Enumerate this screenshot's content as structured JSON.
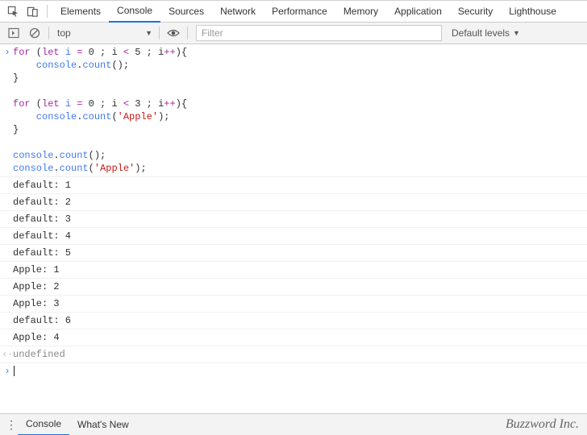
{
  "tabs": {
    "items": [
      "Elements",
      "Console",
      "Sources",
      "Network",
      "Performance",
      "Memory",
      "Application",
      "Security",
      "Lighthouse"
    ],
    "activeIndex": 1
  },
  "toolbar": {
    "context": "top",
    "filter_placeholder": "Filter",
    "levels_label": "Default levels"
  },
  "code": {
    "for1_a": "for",
    "for1_b": " (",
    "for1_c": "let",
    "for1_d": " i ",
    "for1_e": "=",
    "for1_f": " 0 ; i ",
    "for1_g": "<",
    "for1_h": " 5 ; i",
    "for1_i": "++",
    "for1_j": "){",
    "count1_a": "    console",
    "count1_b": ".",
    "count1_c": "count",
    "count1_d": "();",
    "brace1": "}",
    "blank": "",
    "for2_a": "for",
    "for2_b": " (",
    "for2_c": "let",
    "for2_d": " i ",
    "for2_e": "=",
    "for2_f": " 0 ; i ",
    "for2_g": "<",
    "for2_h": " 3 ; i",
    "for2_i": "++",
    "for2_j": "){",
    "count2_a": "    console",
    "count2_b": ".",
    "count2_c": "count",
    "count2_d": "(",
    "count2_e": "'Apple'",
    "count2_f": ");",
    "brace2": "}",
    "tail1_a": "console",
    "tail1_b": ".",
    "tail1_c": "count",
    "tail1_d": "();",
    "tail2_a": "console",
    "tail2_b": ".",
    "tail2_c": "count",
    "tail2_d": "(",
    "tail2_e": "'Apple'",
    "tail2_f": ");"
  },
  "output": [
    "default: 1",
    "default: 2",
    "default: 3",
    "default: 4",
    "default: 5",
    "Apple: 1",
    "Apple: 2",
    "Apple: 3",
    "default: 6",
    "Apple: 4"
  ],
  "return_value": "undefined",
  "drawer": {
    "tabs": [
      "Console",
      "What's New"
    ],
    "activeIndex": 0
  },
  "brand": "Buzzword Inc."
}
